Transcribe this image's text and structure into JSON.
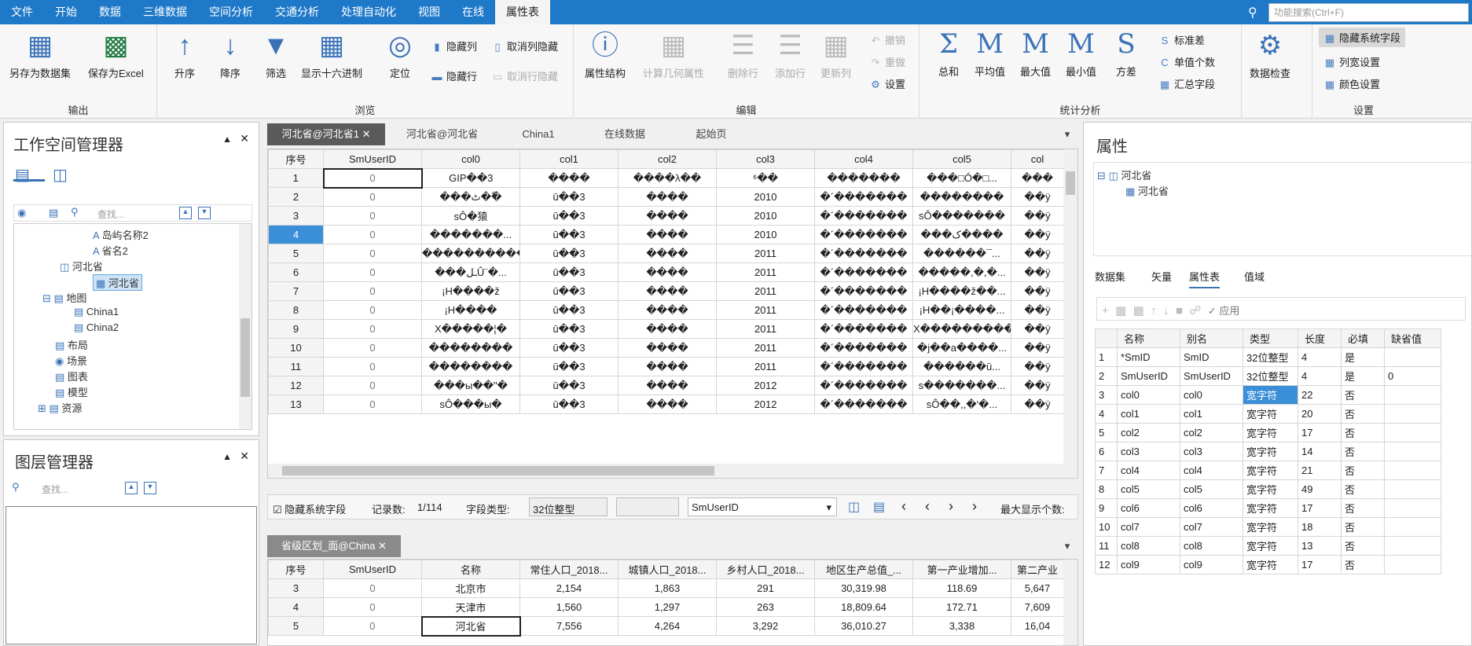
{
  "menubar": {
    "items": [
      "文件",
      "开始",
      "数据",
      "三维数据",
      "空间分析",
      "交通分析",
      "处理自动化",
      "视图",
      "在线",
      "属性表"
    ],
    "search_placeholder": "功能搜索(Ctrl+F)"
  },
  "ribbon": {
    "output": {
      "label": "输出",
      "save_dataset": "另存为数据集",
      "save_excel": "保存为Excel"
    },
    "browse": {
      "label": "浏览",
      "asc": "升序",
      "desc": "降序",
      "filter": "筛选",
      "hex": "显示十六进制",
      "locate": "定位",
      "hide_col": "隐藏列",
      "unhide_col": "取消列隐藏",
      "hide_row": "隐藏行",
      "unhide_row": "取消行隐藏"
    },
    "edit": {
      "label": "编辑",
      "attr_struct": "属性结构",
      "calc_geom": "计算几何属性",
      "del_row": "删除行",
      "add_row": "添加行",
      "update_col": "更新列",
      "undo": "撤销",
      "redo": "重做",
      "settings": "设置"
    },
    "stats": {
      "label": "统计分析",
      "sum": "总和",
      "avg": "平均值",
      "max": "最大值",
      "min": "最小值",
      "var": "方差",
      "std": "标准差",
      "unique": "单值个数",
      "summary": "汇总字段"
    },
    "check": {
      "data_check": "数据检查"
    },
    "settings": {
      "label": "设置",
      "hide_sys": "隐藏系统字段",
      "col_width": "列宽设置",
      "color": "颜色设置"
    }
  },
  "workspace": {
    "title": "工作空间管理器",
    "search_placeholder": "查找...",
    "tree": [
      "岛屿名称2",
      "省名2",
      "河北省",
      "河北省",
      "地图",
      "China1",
      "China2",
      "布局",
      "场景",
      "图表",
      "模型",
      "资源"
    ]
  },
  "layers": {
    "title": "图层管理器",
    "search_placeholder": "查找..."
  },
  "top_tabs": [
    "河北省@河北省1",
    "河北省@河北省",
    "China1",
    "在线数据",
    "起始页"
  ],
  "grid1": {
    "headers": [
      "序号",
      "SmUserID",
      "col0",
      "col1",
      "col2",
      "col3",
      "col4",
      "col5",
      "col"
    ],
    "rows": [
      [
        "1",
        "0",
        "GIP��3",
        "����",
        "����λ��",
        "⁶��",
        "�������",
        "���□Ó�□...",
        "���"
      ],
      [
        "2",
        "0",
        "���ٹ��ّ",
        "ū��3",
        "����",
        "2010",
        "�´�������",
        "��������",
        "��ÿ"
      ],
      [
        "3",
        "0",
        "sÔ�猿",
        "ū��3",
        "����",
        "2010",
        "�´�������",
        "sÔ�������",
        "��ÿ"
      ],
      [
        "4",
        "0",
        "�������...",
        "ū��3",
        "����",
        "2010",
        "�´�������",
        "���ک����",
        "��ÿ"
      ],
      [
        "5",
        "0",
        "�����������",
        "ū��3",
        "����",
        "2011",
        "�´�������",
        "������¯...",
        "��ÿ"
      ],
      [
        "6",
        "0",
        "���ـلÛ¨�...",
        "ū��3",
        "����",
        "2011",
        "�´�������",
        "�����,�,�...",
        "��ÿ"
      ],
      [
        "7",
        "0",
        "¡H����ž",
        "ū��3",
        "����",
        "2011",
        "�´�������",
        "¡H����ž��...",
        "��ÿ"
      ],
      [
        "8",
        "0",
        "¡H����",
        "ū��3",
        "����",
        "2011",
        "�´�������",
        "¡H��¡����...",
        "��ÿ"
      ],
      [
        "9",
        "0",
        "X�����¦�",
        "ū��3",
        "����",
        "2011",
        "�´�������",
        "X���������",
        "��ÿ"
      ],
      [
        "10",
        "0",
        "��������",
        "ū��3",
        "����",
        "2011",
        "�´�������",
        "�j��a����...",
        "��ÿ"
      ],
      [
        "11",
        "0",
        "��������",
        "ū��3",
        "����",
        "2011",
        "�´�������",
        "������ū...",
        "��ÿ"
      ],
      [
        "12",
        "0",
        "���ы��\"�",
        "ū��3",
        "����",
        "2012",
        "�´�������",
        "s�������...",
        "��ÿ"
      ],
      [
        "13",
        "0",
        "sÔ���ы�",
        "ū��3",
        "����",
        "2012",
        "�´�������",
        "sÔ��,,�'�...",
        "��ÿ"
      ]
    ]
  },
  "status_bar": {
    "hide_sys": "隐藏系统字段",
    "record_label": "记录数:",
    "record_value": "1/114",
    "field_type_label": "字段类型:",
    "field_type_value": "32位整型",
    "field_name": "SmUserID",
    "max_display": "最大显示个数:"
  },
  "bottom_tab": "省级区划_面@China",
  "grid2": {
    "headers": [
      "序号",
      "SmUserID",
      "名称",
      "常住人口_2018...",
      "城镇人口_2018...",
      "乡村人口_2018...",
      "地区生产总值_...",
      "第一产业增加...",
      "第二产业"
    ],
    "rows": [
      [
        "3",
        "0",
        "北京市",
        "2,154",
        "1,863",
        "291",
        "30,319.98",
        "118.69",
        "5,647"
      ],
      [
        "4",
        "0",
        "天津市",
        "1,560",
        "1,297",
        "263",
        "18,809.64",
        "172.71",
        "7,609"
      ],
      [
        "5",
        "0",
        "河北省",
        "7,556",
        "4,264",
        "3,292",
        "36,010.27",
        "3,338",
        "16,04"
      ]
    ]
  },
  "properties": {
    "title": "属性",
    "tree_root": "河北省",
    "tree_child": "河北省",
    "tabs": [
      "数据集",
      "矢量",
      "属性表",
      "值域"
    ],
    "apply": "应用",
    "headers": [
      "名称",
      "别名",
      "类型",
      "长度",
      "必填",
      "缺省值"
    ],
    "rows": [
      [
        "1",
        "*SmID",
        "SmID",
        "32位整型",
        "4",
        "是",
        ""
      ],
      [
        "2",
        "SmUserID",
        "SmUserID",
        "32位整型",
        "4",
        "是",
        "0"
      ],
      [
        "3",
        "col0",
        "col0",
        "宽字符",
        "22",
        "否",
        ""
      ],
      [
        "4",
        "col1",
        "col1",
        "宽字符",
        "20",
        "否",
        ""
      ],
      [
        "5",
        "col2",
        "col2",
        "宽字符",
        "17",
        "否",
        ""
      ],
      [
        "6",
        "col3",
        "col3",
        "宽字符",
        "14",
        "否",
        ""
      ],
      [
        "7",
        "col4",
        "col4",
        "宽字符",
        "21",
        "否",
        ""
      ],
      [
        "8",
        "col5",
        "col5",
        "宽字符",
        "49",
        "否",
        ""
      ],
      [
        "9",
        "col6",
        "col6",
        "宽字符",
        "17",
        "否",
        ""
      ],
      [
        "10",
        "col7",
        "col7",
        "宽字符",
        "18",
        "否",
        ""
      ],
      [
        "11",
        "col8",
        "col8",
        "宽字符",
        "13",
        "否",
        ""
      ],
      [
        "12",
        "col9",
        "col9",
        "宽字符",
        "17",
        "否",
        ""
      ]
    ]
  }
}
